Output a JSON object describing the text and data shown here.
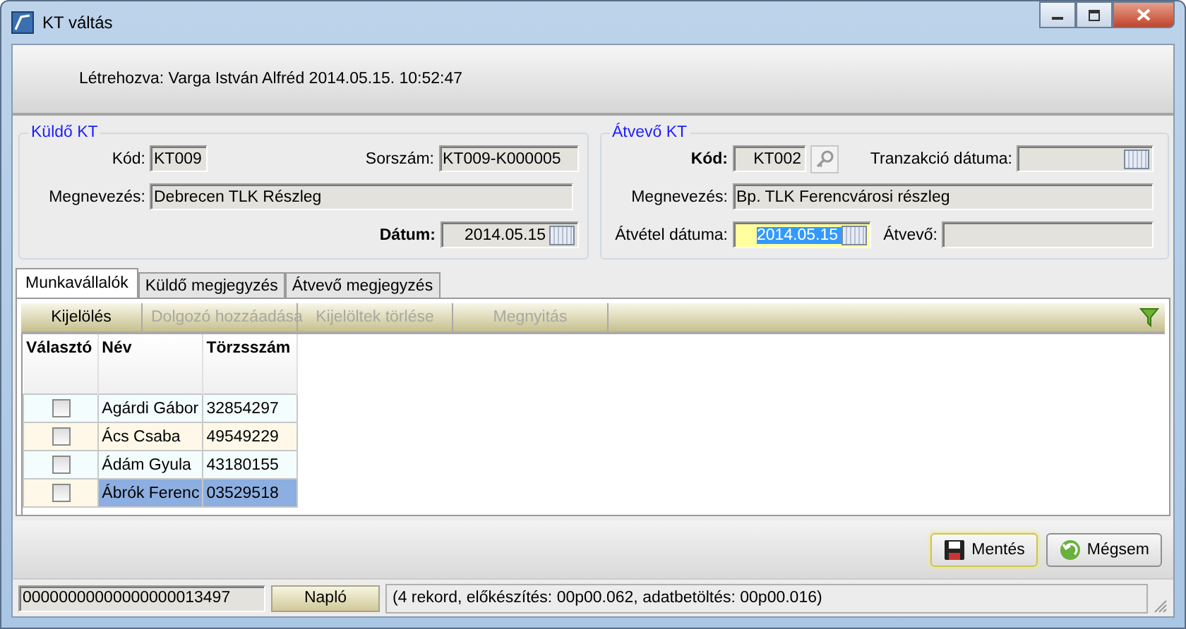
{
  "window": {
    "title": "KT váltás"
  },
  "header": {
    "created": "Létrehozva: Varga István Alfréd 2014.05.15.  10:52:47"
  },
  "sender": {
    "title": "Küldő KT",
    "code_label": "Kód:",
    "code": "KT009",
    "serial_label": "Sorszám:",
    "serial": "KT009-K000005",
    "name_label": "Megnevezés:",
    "name": "Debrecen TLK Részleg",
    "date_label": "Dátum:",
    "date": "2014.05.15"
  },
  "receiver": {
    "title": "Átvevő KT",
    "code_label": "Kód:",
    "code": "KT002",
    "trans_label": "Tranzakció dátuma:",
    "name_label": "Megnevezés:",
    "name": "Bp. TLK Ferencvárosi részleg",
    "date_label": "Átvétel dátuma:",
    "date": "2014.05.15",
    "receiver_label": "Átvevő:"
  },
  "tabs": [
    {
      "label": "Munkavállalók",
      "selected": true
    },
    {
      "label": "Küldő megjegyzés",
      "selected": false
    },
    {
      "label": "Átvevő megjegyzés",
      "selected": false
    }
  ],
  "toolbar": [
    {
      "label": "Kijelölés",
      "disabled": false
    },
    {
      "label": "Dolgozó hozzáadása",
      "disabled": true
    },
    {
      "label": "Kijelöltek törlése",
      "disabled": true
    },
    {
      "label": "Megnyitás",
      "disabled": true
    }
  ],
  "table": {
    "columns": [
      "Választó",
      "Név",
      "Törzsszám"
    ],
    "rows": [
      {
        "checked": false,
        "name": "Agárdi Gábor",
        "number": "32854297",
        "selected": false
      },
      {
        "checked": false,
        "name": "Ács Csaba",
        "number": "49549229",
        "selected": false
      },
      {
        "checked": false,
        "name": "Ádám Gyula",
        "number": "43180155",
        "selected": false
      },
      {
        "checked": false,
        "name": "Ábrók Ferenc",
        "number": "03529518",
        "selected": true
      }
    ]
  },
  "buttons": [
    {
      "label": "Mentés",
      "kind": "save"
    },
    {
      "label": "Mégsem",
      "kind": "cancel"
    }
  ],
  "status_bar": {
    "id": "00000000000000000013497",
    "log_button": "Napló",
    "message": "(4 rekord, előkészítés: 00p00.062, adatbetöltés: 00p00.016)"
  }
}
